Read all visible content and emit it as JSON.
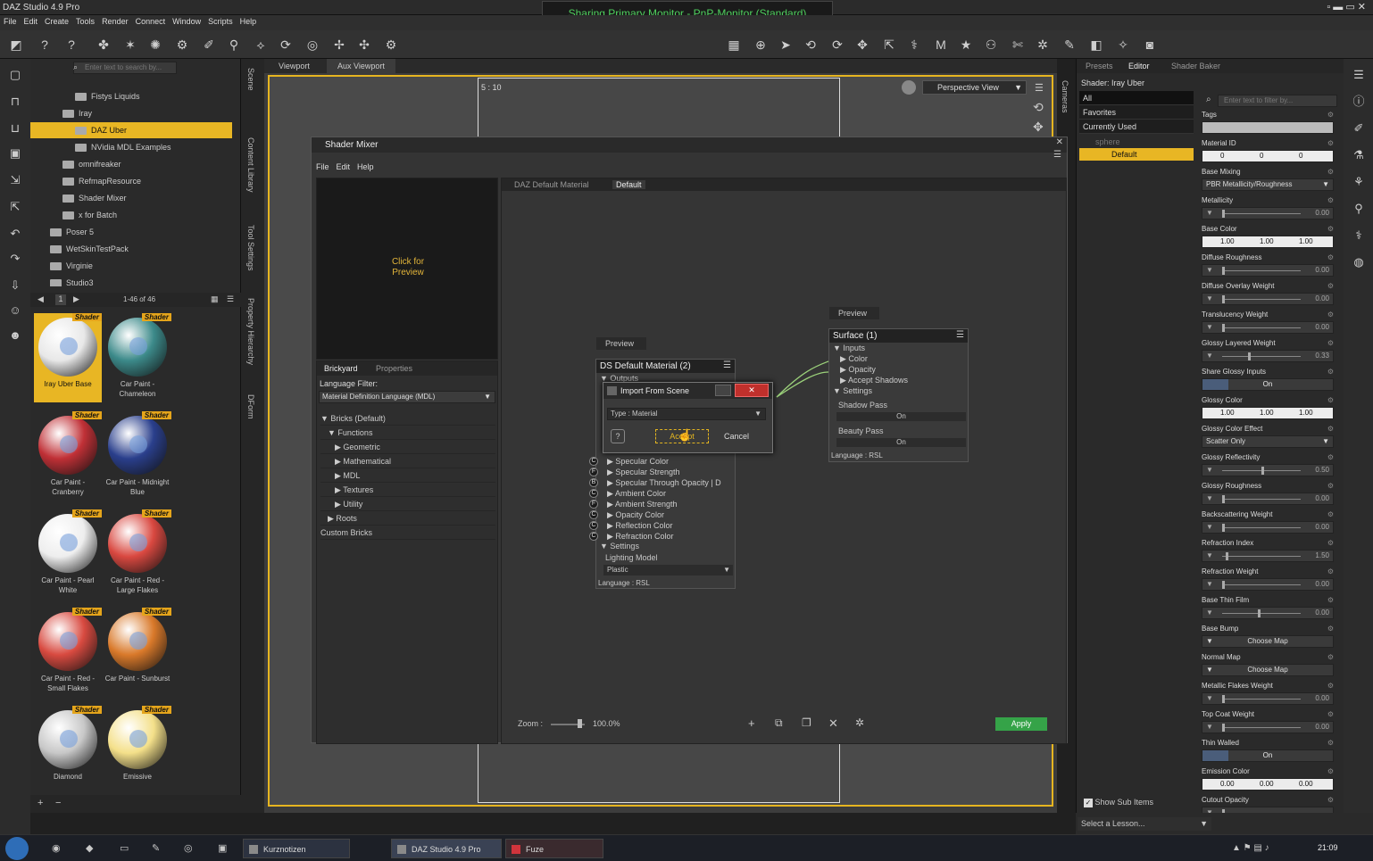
{
  "window": {
    "title": "DAZ Studio 4.9 Pro",
    "banner": "Sharing Primary Monitor - PnP-Monitor (Standard)"
  },
  "menu": [
    "File",
    "Edit",
    "Create",
    "Tools",
    "Render",
    "Connect",
    "Window",
    "Scripts",
    "Help"
  ],
  "content_library": {
    "search_placeholder": "Enter text to search by...",
    "tree": [
      {
        "label": "Fistys Liquids",
        "indent": 2,
        "selected": false
      },
      {
        "label": "Iray",
        "indent": 1,
        "selected": false
      },
      {
        "label": "DAZ Uber",
        "indent": 2,
        "selected": true
      },
      {
        "label": "NVidia MDL Examples",
        "indent": 2,
        "selected": false
      },
      {
        "label": "omnifreaker",
        "indent": 1,
        "selected": false
      },
      {
        "label": "RefmapResource",
        "indent": 1,
        "selected": false
      },
      {
        "label": "Shader Mixer",
        "indent": 1,
        "selected": false
      },
      {
        "label": "x for Batch",
        "indent": 1,
        "selected": false
      },
      {
        "label": "Poser 5",
        "indent": 0,
        "selected": false
      },
      {
        "label": "WetSkinTestPack",
        "indent": 0,
        "selected": false
      },
      {
        "label": "Virginie",
        "indent": 0,
        "selected": false
      },
      {
        "label": "Studio3",
        "indent": 0,
        "selected": false
      }
    ],
    "page": "1",
    "range": "1-46 of 46",
    "badge": "Shader",
    "items": [
      {
        "name": "Iray Uber Base",
        "color": "#e8e8e8",
        "selected": true
      },
      {
        "name": "Car Paint - Chameleon",
        "color": "#3c8a8a",
        "selected": false
      },
      {
        "name": "Car Paint - Cranberry",
        "color": "#c03036",
        "selected": false
      },
      {
        "name": "Car Paint - Midnight Blue",
        "color": "#2a3f8c",
        "selected": false
      },
      {
        "name": "Car Paint - Pearl White",
        "color": "#eeeeee",
        "selected": false
      },
      {
        "name": "Car Paint - Red - Large Flakes",
        "color": "#d94840",
        "selected": false
      },
      {
        "name": "Car Paint - Red - Small Flakes",
        "color": "#d84a40",
        "selected": false
      },
      {
        "name": "Car Paint - Sunburst",
        "color": "#d9792a",
        "selected": false
      },
      {
        "name": "Diamond",
        "color": "#c8c8c8",
        "selected": false
      },
      {
        "name": "Emissive",
        "color": "#f4e08a",
        "selected": false
      }
    ]
  },
  "side_tabs": [
    "Scene",
    "Content Library",
    "Tool Settings",
    "Property Hierarchy",
    "DForm"
  ],
  "viewport": {
    "tabs": [
      "Viewport",
      "Aux Viewport"
    ],
    "ratio": "5 : 10",
    "view": "Perspective View",
    "right_tab": "Cameras"
  },
  "shader_mixer": {
    "title": "Shader Mixer",
    "menu": [
      "File",
      "Edit",
      "Help"
    ],
    "preview_text": "Click for Preview",
    "tabs": [
      "Brickyard",
      "Properties"
    ],
    "lang_filter_label": "Language Filter:",
    "lang_filter_value": "Material Definition Language (MDL)",
    "bricks": [
      {
        "label": "Bricks (Default)",
        "indent": 0
      },
      {
        "label": "Functions",
        "indent": 1
      },
      {
        "label": "Geometric",
        "indent": 2
      },
      {
        "label": "Mathematical",
        "indent": 2
      },
      {
        "label": "MDL",
        "indent": 2
      },
      {
        "label": "Textures",
        "indent": 2
      },
      {
        "label": "Utility",
        "indent": 2
      },
      {
        "label": "Roots",
        "indent": 1
      },
      {
        "label": "Custom Bricks",
        "indent": 0
      }
    ],
    "network_tabs": [
      "DAZ Default Material",
      "Default"
    ],
    "node1": {
      "preview": "Preview",
      "title": "DS Default Material (2)",
      "outputs": "Outputs",
      "rows": [
        {
          "pin": "C",
          "label": "Specular Color"
        },
        {
          "pin": "F",
          "label": "Specular Strength"
        },
        {
          "pin": "B",
          "label": "Specular Through Opacity  | D"
        },
        {
          "pin": "C",
          "label": "Ambient Color"
        },
        {
          "pin": "F",
          "label": "Ambient Strength"
        },
        {
          "pin": "C",
          "label": "Opacity Color"
        },
        {
          "pin": "C",
          "label": "Reflection Color"
        },
        {
          "pin": "C",
          "label": "Refraction Color"
        }
      ],
      "settings": "Settings",
      "lighting_label": "Lighting Model",
      "lighting_value": "Plastic",
      "language": "Language : RSL"
    },
    "node2": {
      "preview": "Preview",
      "title": "Surface (1)",
      "inputs": "Inputs",
      "rows": [
        "Color",
        "Opacity",
        "Accept Shadows"
      ],
      "settings": "Settings",
      "shadow_label": "Shadow Pass",
      "shadow_value": "On",
      "beauty_label": "Beauty Pass",
      "beauty_value": "On",
      "language": "Language : RSL"
    },
    "zoom_label": "Zoom :",
    "zoom_value": "100.0%",
    "apply": "Apply"
  },
  "import_dialog": {
    "title": "Import From Scene",
    "type_label": "Type :",
    "type_value": "Material",
    "accept": "Accept",
    "cancel": "Cancel"
  },
  "surfaces": {
    "tabs": [
      "Presets",
      "Editor",
      "Shader Baker"
    ],
    "shader": "Shader: Iray Uber",
    "filters": [
      "All",
      "Favorites",
      "Currently Used"
    ],
    "tree": [
      {
        "label": "sphere"
      },
      {
        "label": "Default"
      }
    ],
    "filter_placeholder": "Enter text to filter by...",
    "show_sub": "Show Sub Items",
    "props": [
      {
        "label": "Tags",
        "type": "text",
        "value": ""
      },
      {
        "label": "Material ID",
        "type": "triple",
        "v": [
          "0",
          "0",
          "0"
        ]
      },
      {
        "label": "Base Mixing",
        "type": "dropdown",
        "value": "PBR Metallicity/Roughness"
      },
      {
        "label": "Metallicity",
        "type": "slider",
        "value": "0.00",
        "f": 0.0
      },
      {
        "label": "Base Color",
        "type": "triple",
        "v": [
          "1.00",
          "1.00",
          "1.00"
        ]
      },
      {
        "label": "Diffuse Roughness",
        "type": "slider",
        "value": "0.00",
        "f": 0.0
      },
      {
        "label": "Diffuse Overlay Weight",
        "type": "slider",
        "value": "0.00",
        "f": 0.0
      },
      {
        "label": "Translucency Weight",
        "type": "slider",
        "value": "0.00",
        "f": 0.0
      },
      {
        "label": "Glossy Layered Weight",
        "type": "slider",
        "value": "0.33",
        "f": 0.33
      },
      {
        "label": "Share Glossy Inputs",
        "type": "toggle",
        "value": "On"
      },
      {
        "label": "Glossy Color",
        "type": "triple",
        "v": [
          "1.00",
          "1.00",
          "1.00"
        ]
      },
      {
        "label": "Glossy Color Effect",
        "type": "dropdown",
        "value": "Scatter Only"
      },
      {
        "label": "Glossy Reflectivity",
        "type": "slider",
        "value": "0.50",
        "f": 0.5
      },
      {
        "label": "Glossy Roughness",
        "type": "slider",
        "value": "0.00",
        "f": 0.0
      },
      {
        "label": "Backscattering Weight",
        "type": "slider",
        "value": "0.00",
        "f": 0.0
      },
      {
        "label": "Refraction Index",
        "type": "slider",
        "value": "1.50",
        "f": 0.05
      },
      {
        "label": "Refraction Weight",
        "type": "slider",
        "value": "0.00",
        "f": 0.0
      },
      {
        "label": "Base Thin Film",
        "type": "slider",
        "value": "0.00",
        "f": 0.45
      },
      {
        "label": "Base Bump",
        "type": "map",
        "value": "Choose Map"
      },
      {
        "label": "Normal Map",
        "type": "map",
        "value": "Choose Map"
      },
      {
        "label": "Metallic Flakes Weight",
        "type": "slider",
        "value": "0.00",
        "f": 0.0
      },
      {
        "label": "Top Coat Weight",
        "type": "slider",
        "value": "0.00",
        "f": 0.0
      },
      {
        "label": "Thin Walled",
        "type": "toggle",
        "value": "On"
      },
      {
        "label": "Emission Color",
        "type": "triple",
        "v": [
          "0.00",
          "0.00",
          "0.00"
        ]
      },
      {
        "label": "Cutout Opacity",
        "type": "slider",
        "value": "",
        "f": 0.0
      }
    ]
  },
  "lesson": "Select a Lesson...",
  "taskbar": {
    "items": [
      "Kurznotizen",
      "DAZ Studio 4.9 Pro",
      "Fuze"
    ],
    "time": "21:09"
  }
}
